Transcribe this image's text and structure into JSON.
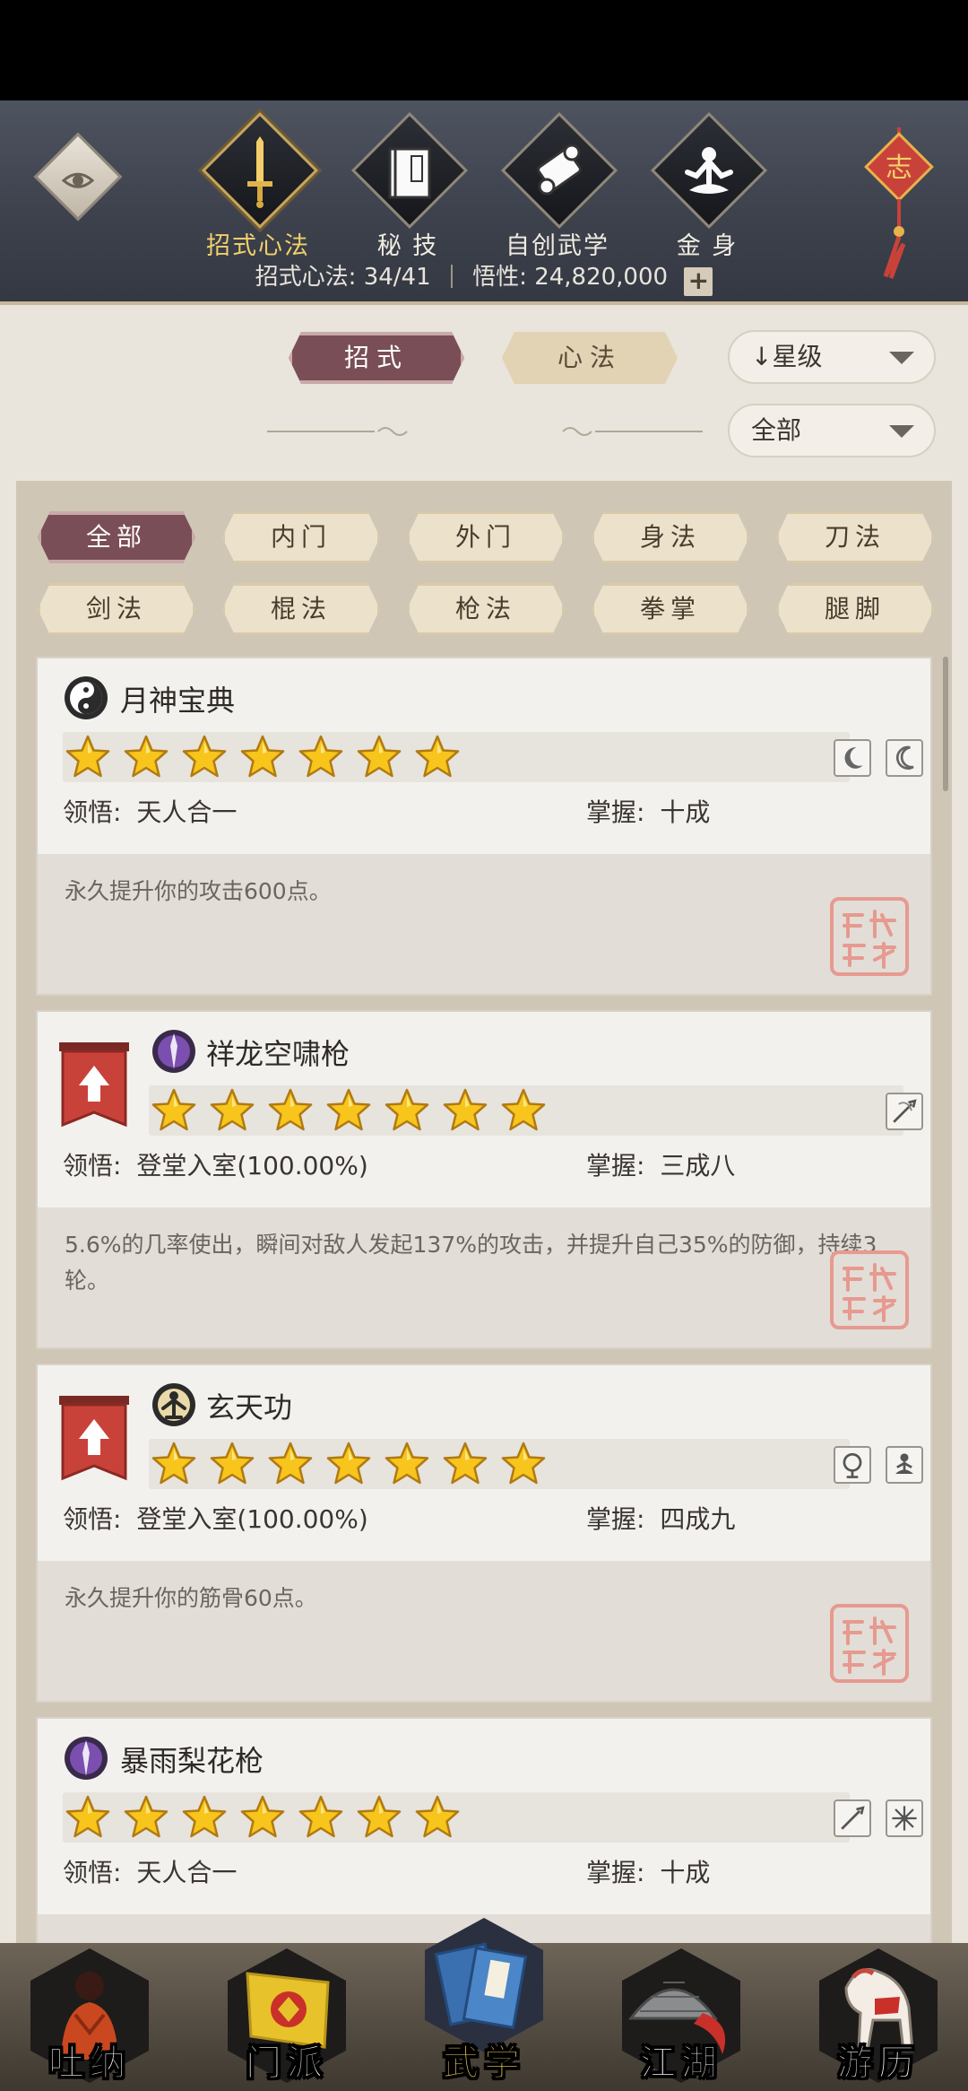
{
  "header": {
    "tabs": [
      {
        "label": "招式心法",
        "icon": "sword-icon",
        "active": true
      },
      {
        "label": "秘 技",
        "icon": "book-icon",
        "active": false
      },
      {
        "label": "自创武学",
        "icon": "scroll-icon",
        "active": false
      },
      {
        "label": "金 身",
        "icon": "meditation-icon",
        "active": false
      }
    ],
    "knot_char": "志",
    "info": {
      "moves_label": "招式心法:",
      "moves_value": "34/41",
      "insight_label": "悟性:",
      "insight_value": "24,820,000",
      "plus": "+"
    }
  },
  "toggle": {
    "moves": "招式",
    "methods": "心法"
  },
  "sort": {
    "label": "↓星级",
    "filter": "全部"
  },
  "chips": [
    "全部",
    "内门",
    "外门",
    "身法",
    "刀法",
    "剑法",
    "棍法",
    "枪法",
    "拳掌",
    "腿脚"
  ],
  "cards": [
    {
      "name": "月神宝典",
      "icon": "yin-yang-icon",
      "stars": 7,
      "upgrade": false,
      "skill_icons": [
        "moon-icon",
        "crescent-icon"
      ],
      "insight_label": "领悟:",
      "insight": "天人合一",
      "mastery_label": "掌握:",
      "mastery": "十成",
      "desc": "永久提升你的攻击600点。",
      "seal": "seal-icon"
    },
    {
      "name": "祥龙空啸枪",
      "icon": "spear-icon",
      "stars": 7,
      "upgrade": true,
      "skill_icons": [
        "spear-strike-icon"
      ],
      "insight_label": "领悟:",
      "insight": "登堂入室(100.00%)",
      "mastery_label": "掌握:",
      "mastery": "三成八",
      "desc": "5.6%的几率使出，瞬间对敌人发起137%的攻击，并提升自己35%的防御，持续3轮。",
      "seal": "seal-icon"
    },
    {
      "name": "玄天功",
      "icon": "golden-body-icon",
      "stars": 7,
      "upgrade": true,
      "skill_icons": [
        "spirit-icon",
        "meditate-icon"
      ],
      "insight_label": "领悟:",
      "insight": "登堂入室(100.00%)",
      "mastery_label": "掌握:",
      "mastery": "四成九",
      "desc": "永久提升你的筋骨60点。",
      "seal": "seal-icon"
    },
    {
      "name": "暴雨梨花枪",
      "icon": "spear-icon",
      "stars": 7,
      "upgrade": false,
      "skill_icons": [
        "spear-strike-icon",
        "flower-icon"
      ],
      "insight_label": "领悟:",
      "insight": "天人合一",
      "mastery_label": "掌握:",
      "mastery": "十成",
      "desc": "",
      "seal": "seal-icon"
    }
  ],
  "nav": [
    {
      "label": "吐纳",
      "icon": "monk-icon",
      "active": false
    },
    {
      "label": "门派",
      "icon": "sect-banner-icon",
      "active": false
    },
    {
      "label": "武学",
      "icon": "martial-books-icon",
      "active": true
    },
    {
      "label": "江湖",
      "icon": "bamboo-hat-icon",
      "active": false
    },
    {
      "label": "游历",
      "icon": "horse-icon",
      "active": false
    }
  ],
  "colors": {
    "accent": "#7a4e56",
    "gold_active": "#f2cf6a",
    "star": "#f5c21b",
    "upgrade_banner": "#c9423a"
  }
}
